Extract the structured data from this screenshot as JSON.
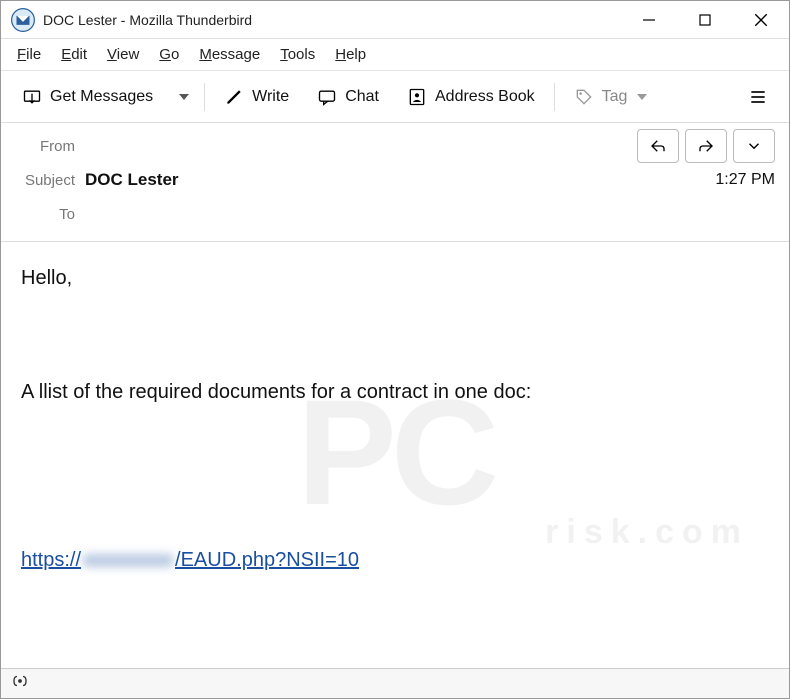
{
  "titlebar": {
    "title": "DOC Lester - Mozilla Thunderbird"
  },
  "menu": {
    "file": "File",
    "edit": "Edit",
    "view": "View",
    "go": "Go",
    "message": "Message",
    "tools": "Tools",
    "help": "Help"
  },
  "toolbar": {
    "get_messages": "Get Messages",
    "write": "Write",
    "chat": "Chat",
    "address_book": "Address Book",
    "tag": "Tag"
  },
  "header": {
    "from_label": "From",
    "from_value": "",
    "subject_label": "Subject",
    "subject_value": "DOC Lester",
    "to_label": "To",
    "to_value": "",
    "time": "1:27 PM"
  },
  "body": {
    "greeting": "Hello,",
    "line1": "A llist of the required documents for a contract in one doc:",
    "link_prefix": "https://",
    "link_blur": "xxxxxxxxx",
    "link_suffix": "/EAUD.php?NSII=10"
  },
  "watermark": {
    "main": "PC",
    "sub": "risk.com"
  }
}
